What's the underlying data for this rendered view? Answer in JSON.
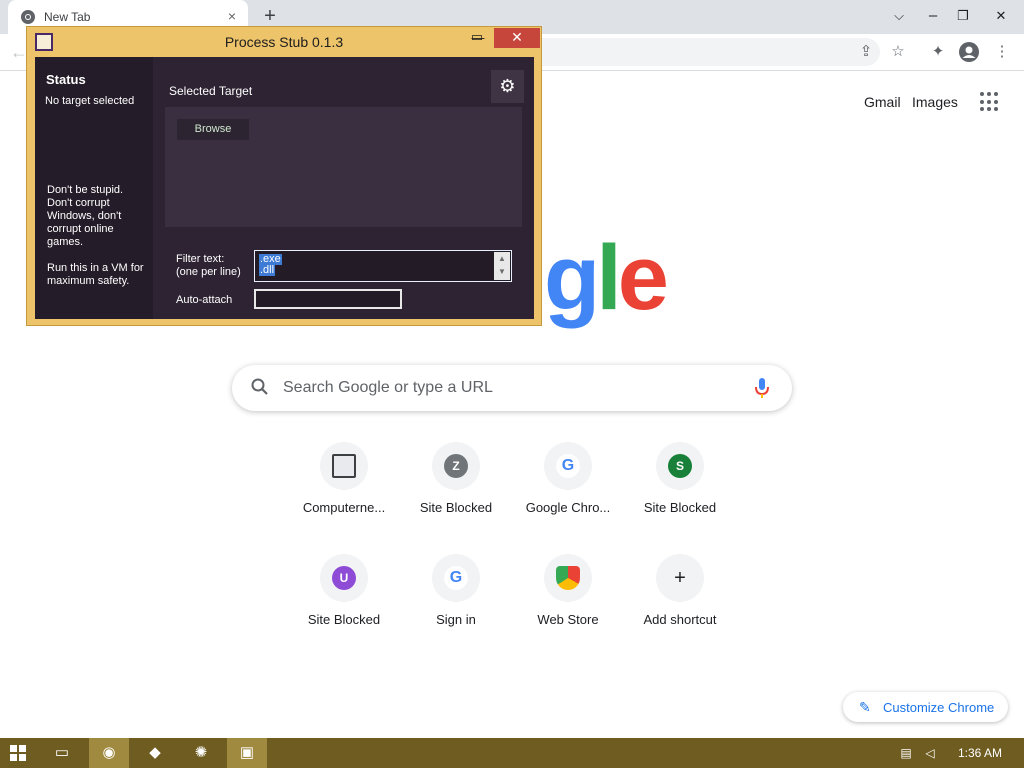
{
  "browser": {
    "tab_title": "New Tab",
    "tab_close": "×",
    "new_tab": "+",
    "win_min": "⌵",
    "win_restore": "❐",
    "win_close": "✕"
  },
  "ntp": {
    "gmail": "Gmail",
    "images": "Images",
    "logo_g": "g",
    "logo_l": "l",
    "logo_e": "e",
    "search_placeholder": "Search Google or type a URL",
    "shortcuts": [
      {
        "label": "Computerne...",
        "icon": "computer-icon",
        "badge": "",
        "color": "#e8eaed"
      },
      {
        "label": "Site Blocked",
        "icon": "letter-icon",
        "badge": "Z",
        "color": "#70757a"
      },
      {
        "label": "Google Chro...",
        "icon": "google-g-icon",
        "badge": "G",
        "color": "#ffffff"
      },
      {
        "label": "Site Blocked",
        "icon": "letter-icon",
        "badge": "S",
        "color": "#188038"
      },
      {
        "label": "Site Blocked",
        "icon": "letter-icon",
        "badge": "U",
        "color": "#8e4bd6"
      },
      {
        "label": "Sign in",
        "icon": "google-g-icon",
        "badge": "G",
        "color": "#ffffff"
      },
      {
        "label": "Web Store",
        "icon": "web-store-icon",
        "badge": "",
        "color": "#ffffff"
      },
      {
        "label": "Add shortcut",
        "icon": "plus-icon",
        "badge": "+",
        "color": "#f1f3f4"
      }
    ],
    "customize": "Customize Chrome"
  },
  "process_stub": {
    "title": "Process Stub 0.1.3",
    "status_heading": "Status",
    "status_value": "No target selected",
    "warning_1": "Don't be stupid. Don't corrupt Windows, don't corrupt online games.",
    "warning_2": "Run this in a VM for maximum safety.",
    "selected_target": "Selected Target",
    "browse": "Browse",
    "filter_label_1": "Filter text:",
    "filter_label_2": "(one per line)",
    "filter_lines": [
      ".exe",
      ".dll"
    ],
    "auto_attach": "Auto-attach",
    "auto_attach_value": ""
  },
  "taskbar": {
    "clock": "1:36 AM"
  }
}
